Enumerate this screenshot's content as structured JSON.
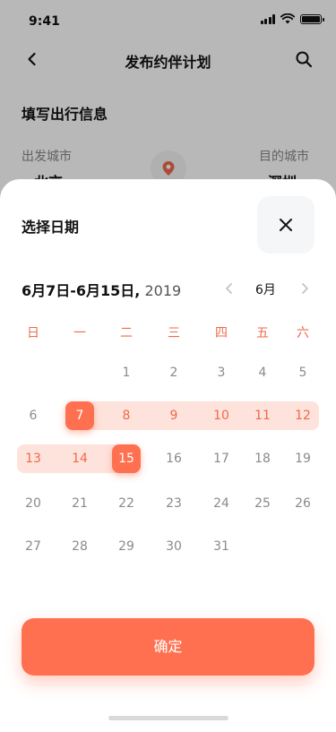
{
  "status_bar": {
    "time": "9:41"
  },
  "nav": {
    "title": "发布约伴计划"
  },
  "form": {
    "section_title": "填写出行信息",
    "from_label": "出发城市",
    "from_city": "北京",
    "to_label": "目的城市",
    "to_city": "深圳"
  },
  "sheet": {
    "title": "选择日期",
    "range_text": "6月7日-6月15日,",
    "year": "2019",
    "month_label": "6月",
    "confirm_label": "确定"
  },
  "weekdays": [
    "日",
    "一",
    "二",
    "三",
    "四",
    "五",
    "六"
  ],
  "calendar": {
    "weeks": [
      [
        "",
        "",
        "1",
        "2",
        "3",
        "4",
        "5"
      ],
      [
        "6",
        "7",
        "8",
        "9",
        "10",
        "11",
        "12"
      ],
      [
        "13",
        "14",
        "15",
        "16",
        "17",
        "18",
        "19"
      ],
      [
        "20",
        "21",
        "22",
        "23",
        "24",
        "25",
        "26"
      ],
      [
        "27",
        "28",
        "29",
        "30",
        "31",
        "",
        ""
      ]
    ],
    "range_start": 7,
    "range_end": 15,
    "accent_color": "#ff7050",
    "range_color": "#fde3dc"
  }
}
